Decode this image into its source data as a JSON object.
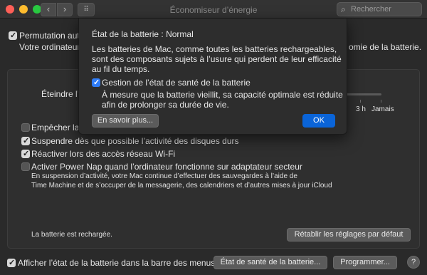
{
  "window": {
    "title": "Économiseur d’énergie",
    "search_placeholder": "Rechercher",
    "back_symbol": "‹",
    "forward_symbol": "›",
    "grid_symbol": "⠿",
    "search_symbol": "⌕"
  },
  "main": {
    "permutation_label": "Permutation autom",
    "permutation_checked": true,
    "permutation_desc_left": "Votre ordinateur po",
    "permutation_desc_right": "omie de la batterie.",
    "eteindre_label": "Éteindre l’é",
    "slider_labels": [
      "3 h",
      "Jamais"
    ],
    "options": [
      {
        "label": "Empêcher la s",
        "checked": false
      },
      {
        "label": "Suspendre dès que possible l’activité des disques durs",
        "checked": true
      },
      {
        "label": "Réactiver lors des accès réseau Wi-Fi",
        "checked": true
      },
      {
        "label": "Activer Power Nap quand l’ordinateur fonctionne sur adaptateur secteur",
        "checked": false
      }
    ],
    "power_nap_desc_1": "En suspension d’activité, votre Mac continue d’effectuer des sauvegardes à l’aide de",
    "power_nap_desc_2": "Time Machine et de s’occuper de la messagerie, des calendriers et d’autres mises à jour iCloud",
    "battery_status": "La batterie est rechargée.",
    "restore_defaults_button": "Rétablir les réglages par défaut"
  },
  "footer": {
    "show_status_label": "Afficher l’état de la batterie dans la barre des menus",
    "show_status_checked": true,
    "battery_health_button": "État de santé de la batterie...",
    "schedule_button": "Programmer...",
    "help_symbol": "?"
  },
  "sheet": {
    "status_line": "État de la batterie :  Normal",
    "body_line_1": "Les batteries de Mac, comme toutes les batteries rechargeables,",
    "body_line_2": "sont des composants sujets à l’usure qui perdent de leur efficacité",
    "body_line_3": "au fil du temps.",
    "management_label": "Gestion de l’état de santé de la batterie",
    "management_checked": true,
    "management_desc_1": "À mesure que la batterie vieillit, sa capacité optimale est réduite",
    "management_desc_2": "afin de prolonger sa durée de vie.",
    "learn_more_button": "En savoir plus...",
    "ok_button": "OK"
  },
  "colors": {
    "accent": "#0a64d8",
    "checkbox_blue": "#2f7cf6",
    "close": "#fe5f57",
    "minimize": "#febc2e",
    "maximize": "#28c840"
  }
}
